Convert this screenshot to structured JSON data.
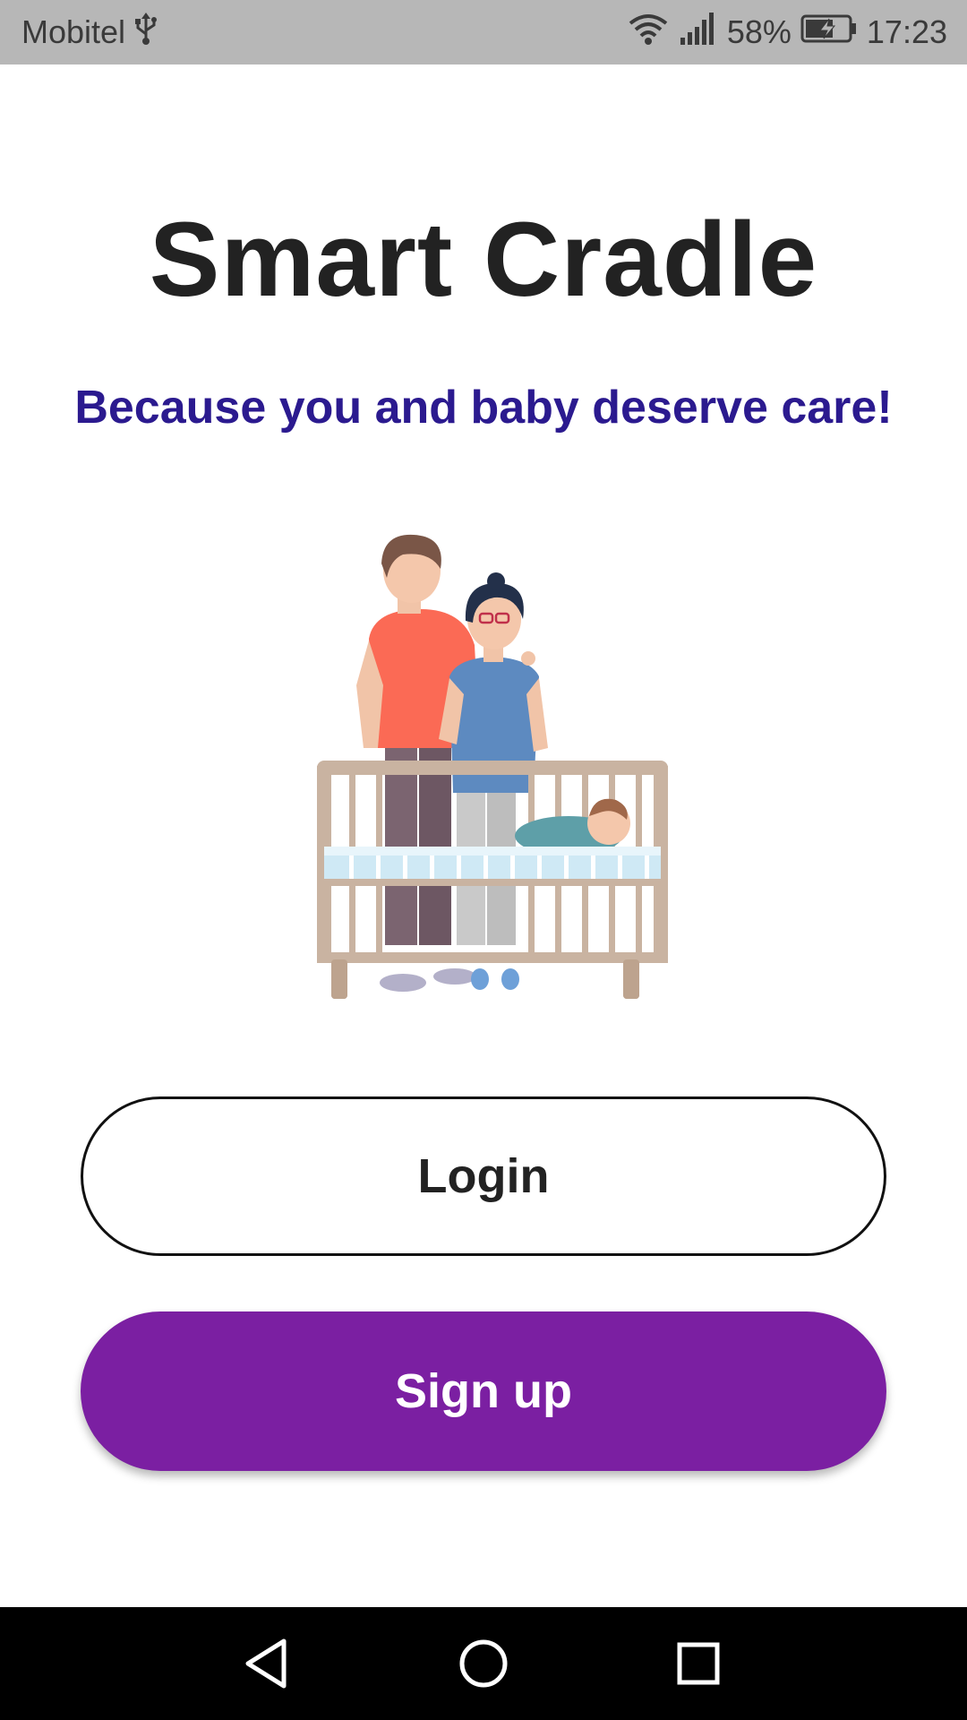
{
  "status_bar": {
    "carrier": "Mobitel",
    "battery_percent": "58%",
    "time": "17:23",
    "icons": [
      "usb-icon",
      "wifi-icon",
      "signal-icon",
      "battery-charging-icon"
    ]
  },
  "main": {
    "title": "Smart Cradle",
    "subtitle": "Because you and baby deserve care!",
    "illustration": "family-with-baby-in-crib",
    "login_label": "Login",
    "signup_label": "Sign up"
  },
  "colors": {
    "title": "#222222",
    "subtitle": "#2b1a8f",
    "signup_button": "#7b1fa2",
    "status_bar": "#b7b7b7"
  },
  "nav_bar": {
    "icons": [
      "back-icon",
      "home-icon",
      "recents-icon"
    ]
  }
}
